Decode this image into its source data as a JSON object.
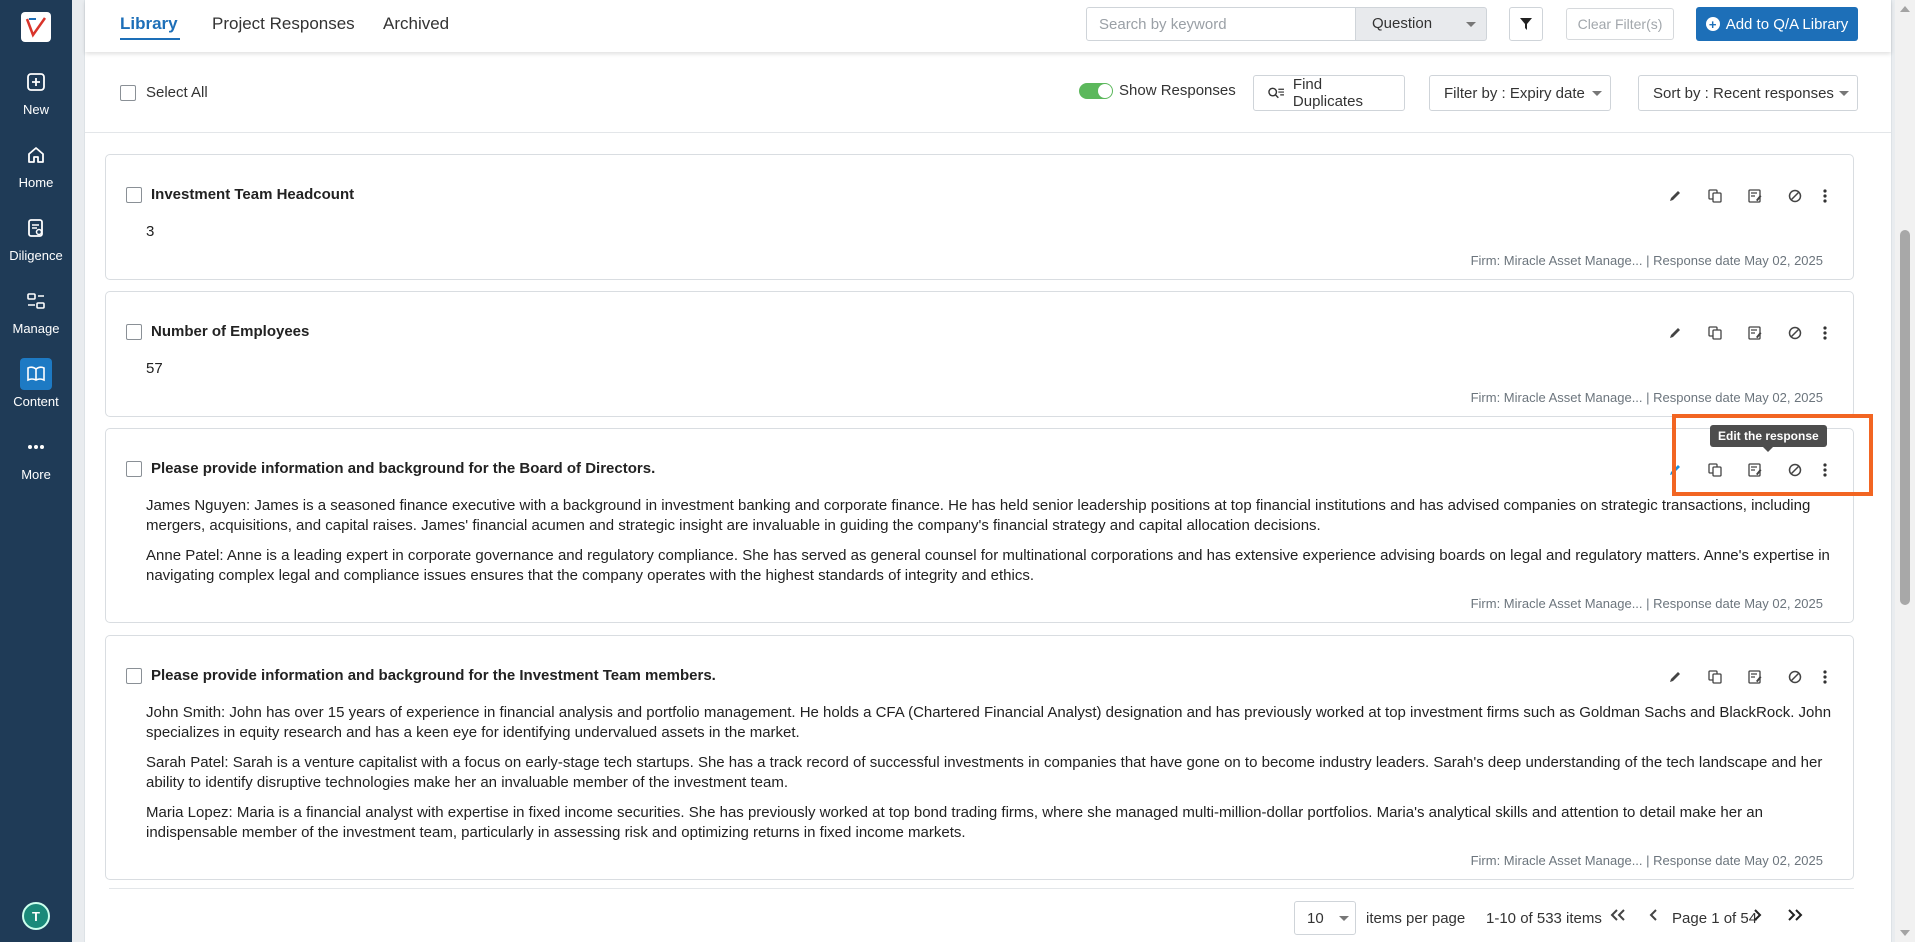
{
  "sidebar": {
    "items": [
      {
        "label": "New",
        "icon": "plus-square-icon"
      },
      {
        "label": "Home",
        "icon": "home-icon"
      },
      {
        "label": "Diligence",
        "icon": "diligence-icon"
      },
      {
        "label": "Manage",
        "icon": "manage-icon"
      },
      {
        "label": "Content",
        "icon": "book-icon",
        "active": true
      },
      {
        "label": "More",
        "icon": "more-dots-icon"
      }
    ],
    "avatar_initial": "T"
  },
  "header": {
    "tabs": [
      {
        "label": "Library",
        "active": true
      },
      {
        "label": "Project Responses"
      },
      {
        "label": "Archived"
      }
    ],
    "search_placeholder": "Search by keyword",
    "search_scope": "Question",
    "clear_filters": "Clear Filter(s)",
    "add_button": "Add to Q/A Library"
  },
  "toolbar": {
    "select_all": "Select All",
    "show_responses": "Show Responses",
    "show_responses_on": true,
    "find_duplicates": "Find Duplicates",
    "filter_by": "Filter by : Expiry date",
    "sort_by": "Sort by : Recent responses"
  },
  "cards": [
    {
      "title": "Investment Team Headcount",
      "paragraphs": [
        "3"
      ],
      "firm": "Firm: Miracle Asset Manage...",
      "response_date": "Response date May 02, 2025"
    },
    {
      "title": "Number of Employees",
      "paragraphs": [
        "57"
      ],
      "firm": "Firm: Miracle Asset Manage...",
      "response_date": "Response date May 02, 2025"
    },
    {
      "title": "Please provide information and background for the Board of Directors.",
      "paragraphs": [
        "James Nguyen: James is a seasoned finance executive with a background in investment banking and corporate finance. He has held senior leadership positions at top financial institutions and has advised companies on strategic transactions, including mergers, acquisitions, and capital raises. James' financial acumen and strategic insight are invaluable in guiding the company's financial strategy and capital allocation decisions.",
        "Anne Patel: Anne is a leading expert in corporate governance and regulatory compliance. She has served as general counsel for multinational corporations and has extensive experience advising boards on legal and regulatory matters. Anne's expertise in navigating complex legal and compliance issues ensures that the company operates with the highest standards of integrity and ethics."
      ],
      "firm": "Firm: Miracle Asset Manage...",
      "response_date": "Response date May 02, 2025"
    },
    {
      "title": "Please provide information and background for the Investment Team members.",
      "paragraphs": [
        "John Smith: John has over 15 years of experience in financial analysis and portfolio management. He holds a CFA (Chartered Financial Analyst) designation and has previously worked at top investment firms such as Goldman Sachs and BlackRock. John specializes in equity research and has a keen eye for identifying undervalued assets in the market.",
        "Sarah Patel: Sarah is a venture capitalist with a focus on early-stage tech startups. She has a track record of successful investments in companies that have gone on to become industry leaders. Sarah's deep understanding of the tech landscape and her ability to identify disruptive technologies make her an invaluable member of the investment team.",
        "Maria Lopez: Maria is a financial analyst with expertise in fixed income securities. She has previously worked at top bond trading firms, where she managed multi-million-dollar portfolios. Maria's analytical skills and attention to detail make her an indispensable member of the investment team, particularly in assessing risk and optimizing returns in fixed income markets."
      ],
      "firm": "Firm: Miracle Asset Manage...",
      "response_date": "Response date May 02, 2025"
    }
  ],
  "tooltip": "Edit the response",
  "pagination": {
    "per_page": "10",
    "items_per_page_label": "items per page",
    "range": "1-10 of 533 items",
    "page_label": "Page 1 of 54"
  },
  "colors": {
    "sidebar": "#1f3b57",
    "accent": "#1d6fb8",
    "highlight": "#f26522",
    "toggle_on": "#5cb85c"
  }
}
